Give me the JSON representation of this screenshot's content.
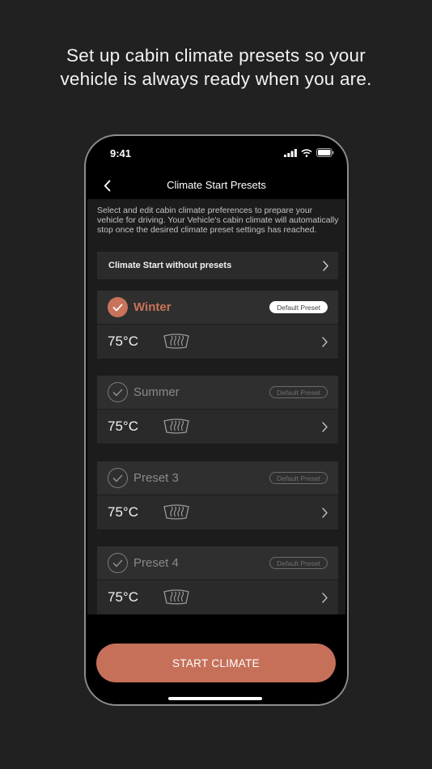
{
  "headline": "Set up cabin climate presets so your vehicle is always ready when you are.",
  "status_bar": {
    "time": "9:41"
  },
  "nav": {
    "title": "Climate Start Presets"
  },
  "intro": "Select and edit cabin climate preferences to prepare your vehicle for driving. Your Vehicle's cabin climate will automatically stop once the desired climate preset settings has reached.",
  "no_preset_row": {
    "label": "Climate Start without presets"
  },
  "presets": [
    {
      "name": "Winter",
      "badge": "Default Preset",
      "temp": "75°C",
      "selected": true
    },
    {
      "name": "Summer",
      "badge": "Default Preset",
      "temp": "75°C",
      "selected": false
    },
    {
      "name": "Preset 3",
      "badge": "Default Preset",
      "temp": "75°C",
      "selected": false
    },
    {
      "name": "Preset 4",
      "badge": "Default Preset",
      "temp": "75°C",
      "selected": false
    }
  ],
  "cta": {
    "label": "START CLIMATE"
  },
  "colors": {
    "accent": "#c9735a",
    "background": "#212121",
    "card": "#2a2a2a"
  },
  "icons": [
    "back-chevron-icon",
    "chevron-right-icon",
    "check-icon",
    "rear-defrost-icon",
    "signal-icon",
    "wifi-icon",
    "battery-icon"
  ]
}
